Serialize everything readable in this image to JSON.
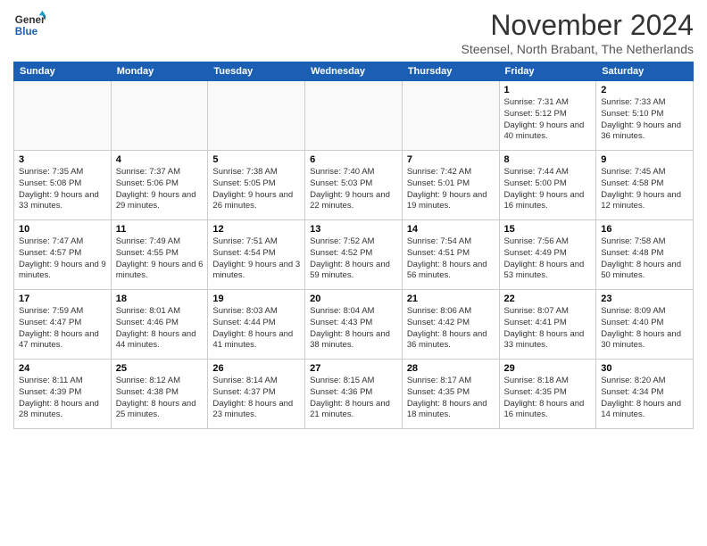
{
  "logo": {
    "general": "General",
    "blue": "Blue"
  },
  "header": {
    "month": "November 2024",
    "location": "Steensel, North Brabant, The Netherlands"
  },
  "days_of_week": [
    "Sunday",
    "Monday",
    "Tuesday",
    "Wednesday",
    "Thursday",
    "Friday",
    "Saturday"
  ],
  "weeks": [
    [
      {
        "day": "",
        "info": ""
      },
      {
        "day": "",
        "info": ""
      },
      {
        "day": "",
        "info": ""
      },
      {
        "day": "",
        "info": ""
      },
      {
        "day": "",
        "info": ""
      },
      {
        "day": "1",
        "info": "Sunrise: 7:31 AM\nSunset: 5:12 PM\nDaylight: 9 hours and 40 minutes."
      },
      {
        "day": "2",
        "info": "Sunrise: 7:33 AM\nSunset: 5:10 PM\nDaylight: 9 hours and 36 minutes."
      }
    ],
    [
      {
        "day": "3",
        "info": "Sunrise: 7:35 AM\nSunset: 5:08 PM\nDaylight: 9 hours and 33 minutes."
      },
      {
        "day": "4",
        "info": "Sunrise: 7:37 AM\nSunset: 5:06 PM\nDaylight: 9 hours and 29 minutes."
      },
      {
        "day": "5",
        "info": "Sunrise: 7:38 AM\nSunset: 5:05 PM\nDaylight: 9 hours and 26 minutes."
      },
      {
        "day": "6",
        "info": "Sunrise: 7:40 AM\nSunset: 5:03 PM\nDaylight: 9 hours and 22 minutes."
      },
      {
        "day": "7",
        "info": "Sunrise: 7:42 AM\nSunset: 5:01 PM\nDaylight: 9 hours and 19 minutes."
      },
      {
        "day": "8",
        "info": "Sunrise: 7:44 AM\nSunset: 5:00 PM\nDaylight: 9 hours and 16 minutes."
      },
      {
        "day": "9",
        "info": "Sunrise: 7:45 AM\nSunset: 4:58 PM\nDaylight: 9 hours and 12 minutes."
      }
    ],
    [
      {
        "day": "10",
        "info": "Sunrise: 7:47 AM\nSunset: 4:57 PM\nDaylight: 9 hours and 9 minutes."
      },
      {
        "day": "11",
        "info": "Sunrise: 7:49 AM\nSunset: 4:55 PM\nDaylight: 9 hours and 6 minutes."
      },
      {
        "day": "12",
        "info": "Sunrise: 7:51 AM\nSunset: 4:54 PM\nDaylight: 9 hours and 3 minutes."
      },
      {
        "day": "13",
        "info": "Sunrise: 7:52 AM\nSunset: 4:52 PM\nDaylight: 8 hours and 59 minutes."
      },
      {
        "day": "14",
        "info": "Sunrise: 7:54 AM\nSunset: 4:51 PM\nDaylight: 8 hours and 56 minutes."
      },
      {
        "day": "15",
        "info": "Sunrise: 7:56 AM\nSunset: 4:49 PM\nDaylight: 8 hours and 53 minutes."
      },
      {
        "day": "16",
        "info": "Sunrise: 7:58 AM\nSunset: 4:48 PM\nDaylight: 8 hours and 50 minutes."
      }
    ],
    [
      {
        "day": "17",
        "info": "Sunrise: 7:59 AM\nSunset: 4:47 PM\nDaylight: 8 hours and 47 minutes."
      },
      {
        "day": "18",
        "info": "Sunrise: 8:01 AM\nSunset: 4:46 PM\nDaylight: 8 hours and 44 minutes."
      },
      {
        "day": "19",
        "info": "Sunrise: 8:03 AM\nSunset: 4:44 PM\nDaylight: 8 hours and 41 minutes."
      },
      {
        "day": "20",
        "info": "Sunrise: 8:04 AM\nSunset: 4:43 PM\nDaylight: 8 hours and 38 minutes."
      },
      {
        "day": "21",
        "info": "Sunrise: 8:06 AM\nSunset: 4:42 PM\nDaylight: 8 hours and 36 minutes."
      },
      {
        "day": "22",
        "info": "Sunrise: 8:07 AM\nSunset: 4:41 PM\nDaylight: 8 hours and 33 minutes."
      },
      {
        "day": "23",
        "info": "Sunrise: 8:09 AM\nSunset: 4:40 PM\nDaylight: 8 hours and 30 minutes."
      }
    ],
    [
      {
        "day": "24",
        "info": "Sunrise: 8:11 AM\nSunset: 4:39 PM\nDaylight: 8 hours and 28 minutes."
      },
      {
        "day": "25",
        "info": "Sunrise: 8:12 AM\nSunset: 4:38 PM\nDaylight: 8 hours and 25 minutes."
      },
      {
        "day": "26",
        "info": "Sunrise: 8:14 AM\nSunset: 4:37 PM\nDaylight: 8 hours and 23 minutes."
      },
      {
        "day": "27",
        "info": "Sunrise: 8:15 AM\nSunset: 4:36 PM\nDaylight: 8 hours and 21 minutes."
      },
      {
        "day": "28",
        "info": "Sunrise: 8:17 AM\nSunset: 4:35 PM\nDaylight: 8 hours and 18 minutes."
      },
      {
        "day": "29",
        "info": "Sunrise: 8:18 AM\nSunset: 4:35 PM\nDaylight: 8 hours and 16 minutes."
      },
      {
        "day": "30",
        "info": "Sunrise: 8:20 AM\nSunset: 4:34 PM\nDaylight: 8 hours and 14 minutes."
      }
    ]
  ]
}
